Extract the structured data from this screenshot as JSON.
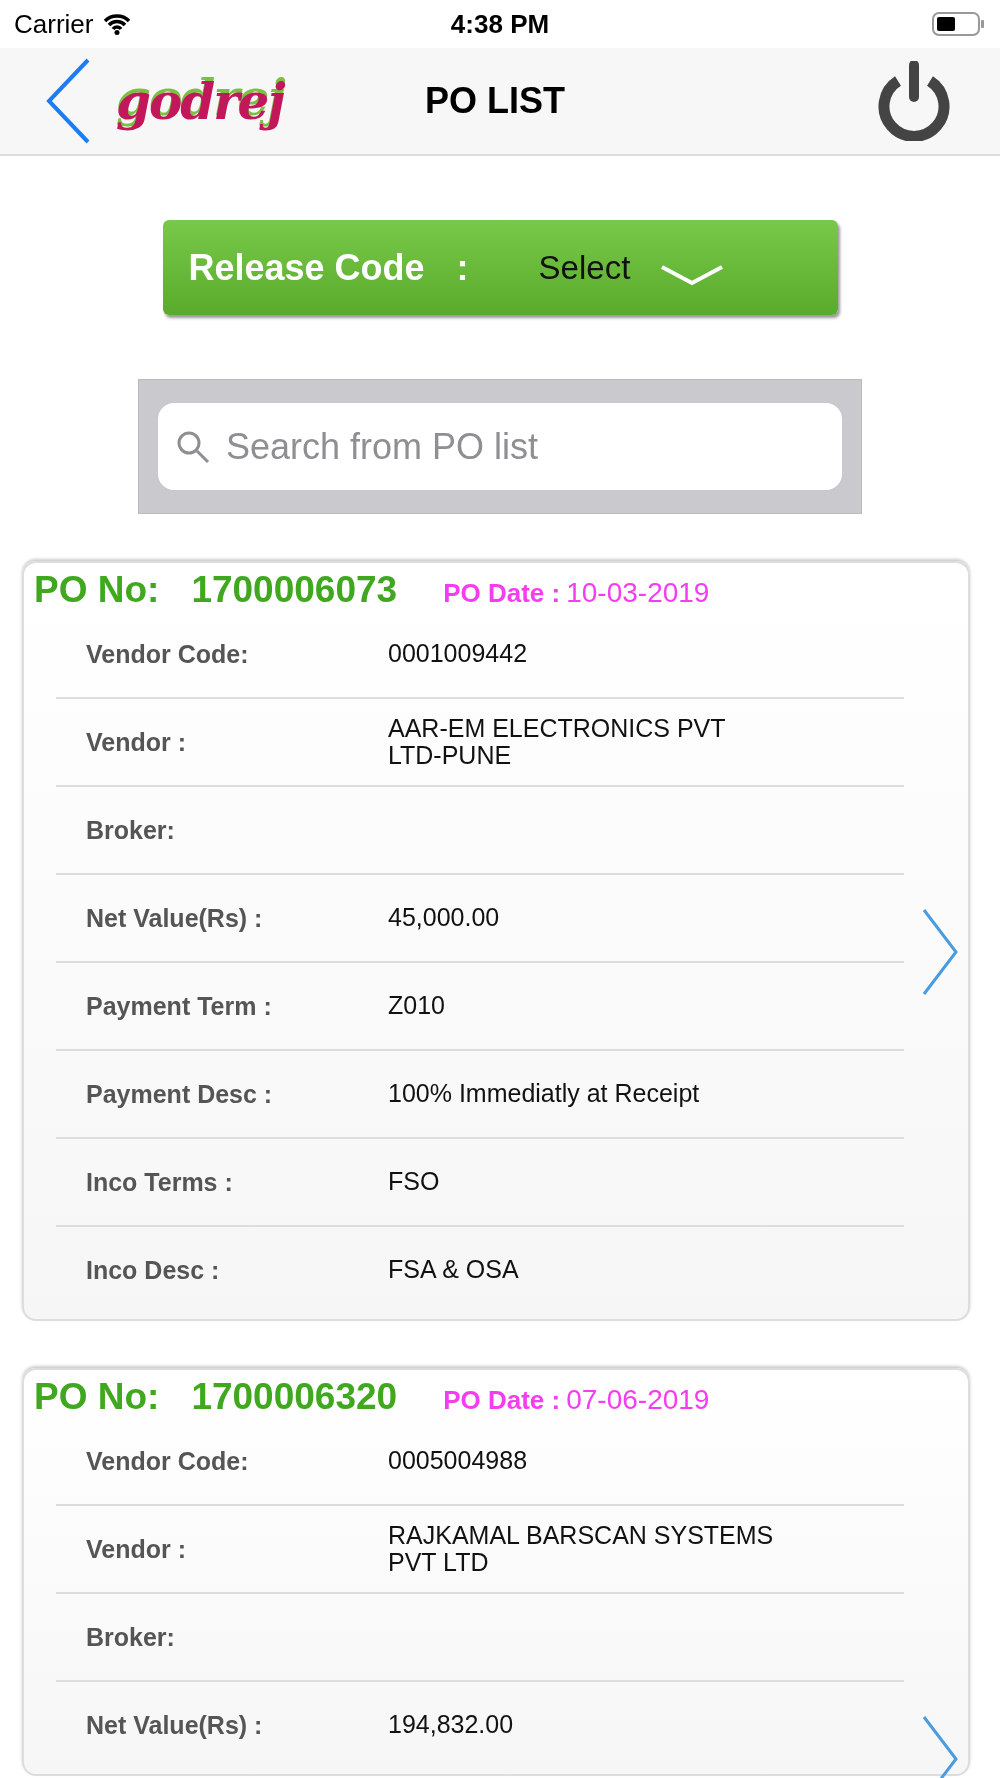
{
  "status_bar": {
    "carrier": "Carrier",
    "time": "4:38 PM"
  },
  "nav_bar": {
    "logo": "godrej",
    "title": "PO LIST"
  },
  "release_code": {
    "label": "Release Code",
    "separator": ":",
    "value": "Select"
  },
  "search": {
    "placeholder": "Search from PO list"
  },
  "orders": [
    {
      "po_label": "PO No:",
      "po_number": "1700006073",
      "date_label": "PO Date :",
      "date": "10-03-2019",
      "rows": [
        {
          "label": "Vendor  Code:",
          "value": "0001009442"
        },
        {
          "label": "Vendor :",
          "value": "AAR-EM ELECTRONICS PVT\nLTD-PUNE"
        },
        {
          "label": "Broker:",
          "value": ""
        },
        {
          "label": "Net Value(Rs) :",
          "value": "45,000.00"
        },
        {
          "label": "Payment Term :",
          "value": "Z010"
        },
        {
          "label": "Payment Desc :",
          "value": "100% Immediatly at Receipt"
        },
        {
          "label": "Inco Terms :",
          "value": "FSO"
        },
        {
          "label": "Inco Desc :",
          "value": "FSA & OSA"
        }
      ]
    },
    {
      "po_label": "PO No:",
      "po_number": "1700006320",
      "date_label": "PO Date :",
      "date": "07-06-2019",
      "rows": [
        {
          "label": "Vendor  Code:",
          "value": "0005004988"
        },
        {
          "label": "Vendor :",
          "value": "RAJKAMAL BARSCAN SYSTEMS\nPVT LTD"
        },
        {
          "label": "Broker:",
          "value": ""
        },
        {
          "label": "Net Value(Rs) :",
          "value": "194,832.00"
        }
      ]
    }
  ]
}
